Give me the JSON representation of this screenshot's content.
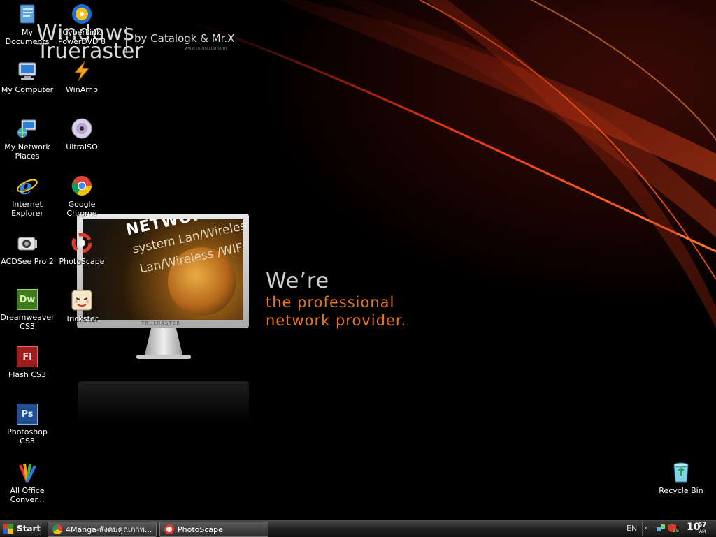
{
  "wallpaper": {
    "brand_line1": "Windows",
    "brand_line2": "Trueraster",
    "brand_by": "by Catalogk & Mr.X",
    "brand_url": "www.trueraster.com",
    "monitor_line1": "NETWORK",
    "monitor_line2": "system Lan/Wireless",
    "monitor_line3": "Lan/Wireless /WIFI",
    "monitor_brand": "TRUERASTER",
    "tagline_1": "We’re",
    "tagline_2": "the professional",
    "tagline_3": "network provider.",
    "accent_color": "#e8741c"
  },
  "desktop_icons": [
    {
      "id": "my-documents",
      "label": "My Documents",
      "icon": "folder-documents-icon"
    },
    {
      "id": "cyberlink",
      "label": "CyberLink PowerDVD 8",
      "icon": "dvd-player-icon"
    },
    {
      "id": "my-computer",
      "label": "My Computer",
      "icon": "computer-icon"
    },
    {
      "id": "winamp",
      "label": "WinAmp",
      "icon": "winamp-icon"
    },
    {
      "id": "network-places",
      "label": "My Network Places",
      "icon": "network-icon"
    },
    {
      "id": "ultraiso",
      "label": "UltraISO",
      "icon": "disc-icon"
    },
    {
      "id": "internet-explorer",
      "label": "Internet Explorer",
      "icon": "internet-explorer-icon"
    },
    {
      "id": "chrome",
      "label": "Google Chrome",
      "icon": "chrome-icon"
    },
    {
      "id": "acdsee",
      "label": "ACDSee Pro 2",
      "icon": "acdsee-icon"
    },
    {
      "id": "photoscape",
      "label": "PhotoScape",
      "icon": "photoscape-icon"
    },
    {
      "id": "dreamweaver",
      "label": "Dreamweaver CS3",
      "icon": "dreamweaver-icon",
      "glyph": "Dw"
    },
    {
      "id": "trickster",
      "label": "Trickster",
      "icon": "trickster-icon"
    },
    {
      "id": "flash",
      "label": "Flash CS3",
      "icon": "flash-icon",
      "glyph": "Fl"
    },
    {
      "id": "photoshop",
      "label": "Photoshop CS3",
      "icon": "photoshop-icon",
      "glyph": "Ps"
    },
    {
      "id": "office-converter",
      "label": "All Office Conver...",
      "icon": "office-converter-icon"
    },
    {
      "id": "recycle-bin",
      "label": "Recycle Bin",
      "icon": "recycle-bin-icon"
    }
  ],
  "taskbar": {
    "start_label": "Start",
    "tasks": [
      {
        "label": "4Manga-สังคมคุณภาพ...",
        "icon": "chrome-icon"
      },
      {
        "label": "PhotoScape",
        "icon": "photoscape-icon"
      }
    ],
    "language": "EN",
    "tray_badge": "28",
    "clock_hour": "10",
    "clock_minute": "57",
    "clock_ampm": "AM"
  }
}
